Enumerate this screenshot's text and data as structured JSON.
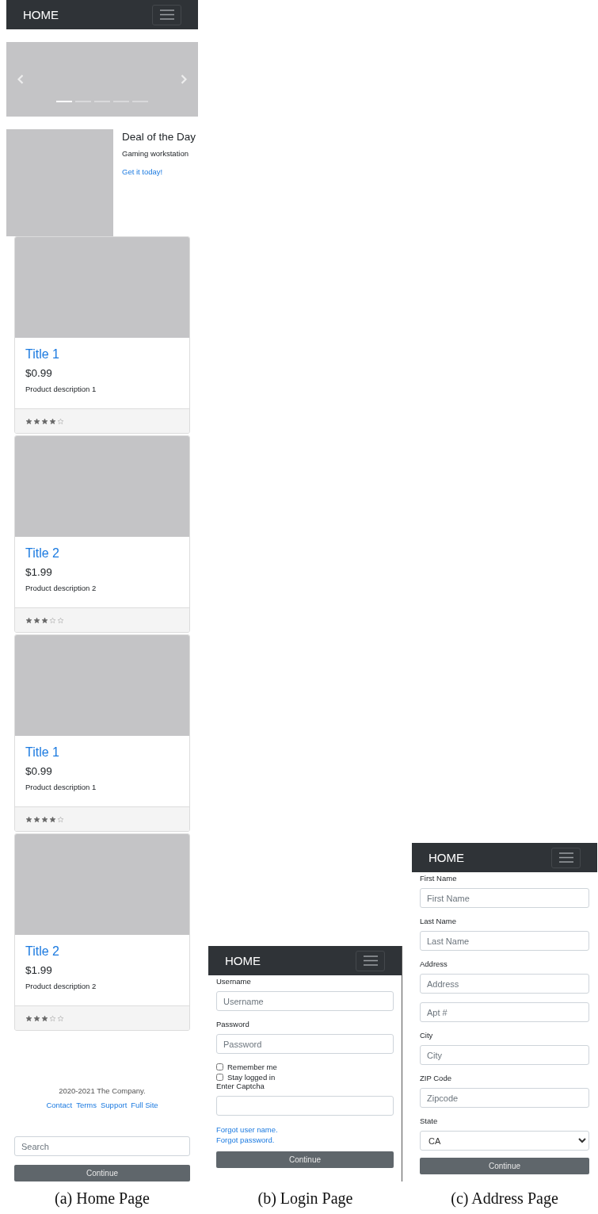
{
  "figures": [
    {
      "kind": "home",
      "caption": "(a) Home Page",
      "navbar": {
        "brand": "HOME"
      },
      "carousel": {
        "indicators": [
          {
            "selected": true
          },
          {
            "selected": false
          },
          {
            "selected": false
          },
          {
            "selected": false
          },
          {
            "selected": false
          }
        ]
      },
      "deal": {
        "title": "Deal of the Day",
        "subtitle": "Gaming workstation",
        "link": "Get it today!"
      },
      "cards": [
        {
          "title": "Title 1",
          "price": "$0.99",
          "description": "Product description 1",
          "stars": 4
        },
        {
          "title": "Title 2",
          "price": "$1.99",
          "description": "Product description 2",
          "stars": 3
        },
        {
          "title": "Title 1",
          "price": "$0.99",
          "description": "Product description 1",
          "stars": 4
        },
        {
          "title": "Title 2",
          "price": "$1.99",
          "description": "Product description 2",
          "stars": 3
        }
      ],
      "footer": {
        "copyright": "2020-2021 The Company.",
        "links": [
          "Contact",
          "Terms",
          "Support",
          "Full Site"
        ]
      },
      "search": {
        "placeholder": "Search"
      },
      "button": "Continue"
    },
    {
      "kind": "login",
      "caption": "(b) Login Page",
      "navbar": {
        "brand": "HOME"
      },
      "fields": [
        {
          "kind": "input",
          "label": "Username",
          "placeholder": "Username"
        },
        {
          "kind": "input",
          "label": "Password",
          "placeholder": "Password"
        },
        {
          "kind": "checkbox",
          "label": "Remember me",
          "checked": false
        },
        {
          "kind": "checkbox",
          "label": "Stay logged in",
          "checked": false
        },
        {
          "kind": "input",
          "label": "Enter Captcha"
        },
        {
          "kind": "link",
          "label": "Forgot user name."
        },
        {
          "kind": "link",
          "label": "Forgot password."
        }
      ],
      "button": "Continue"
    },
    {
      "kind": "address",
      "caption": "(c) Address Page",
      "navbar": {
        "brand": "HOME"
      },
      "fields": [
        {
          "kind": "input",
          "label": "First Name",
          "placeholder": "First Name"
        },
        {
          "kind": "input",
          "label": "Last Name",
          "placeholder": "Last Name"
        },
        {
          "kind": "input",
          "label": "Address",
          "placeholder": "Address"
        },
        {
          "kind": "input",
          "placeholder": "Apt #"
        },
        {
          "kind": "input",
          "label": "City",
          "placeholder": "City"
        },
        {
          "kind": "input",
          "label": "ZIP Code",
          "placeholder": "Zipcode"
        },
        {
          "kind": "select",
          "label": "State",
          "value": "CA"
        }
      ],
      "button": "Continue"
    }
  ]
}
